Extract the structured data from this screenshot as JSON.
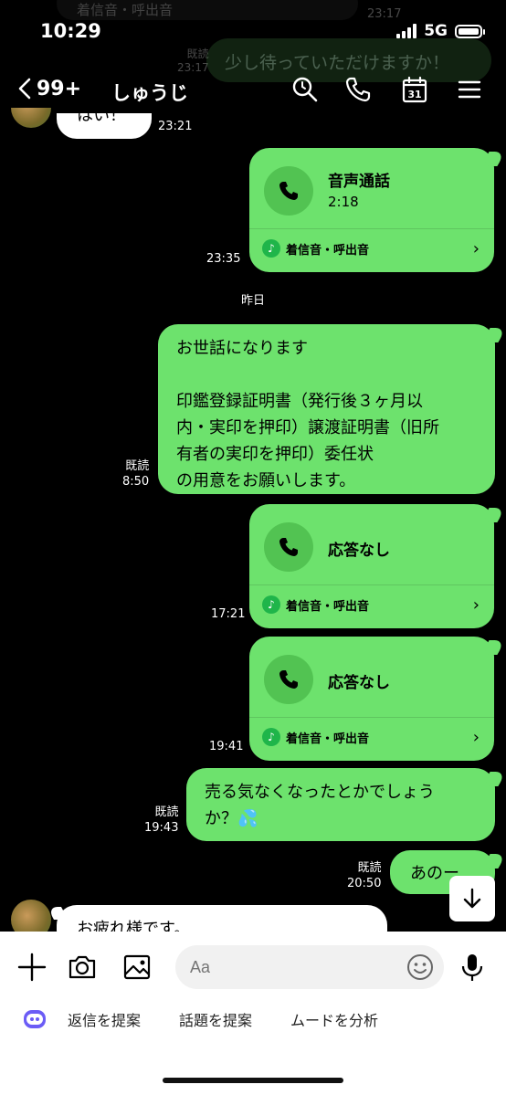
{
  "status": {
    "time": "10:29",
    "network": "5G"
  },
  "faded": {
    "top_text": "着信音・呼出音",
    "top_time": "23:17",
    "read": "既読",
    "read_time": "23:17",
    "green_text": "少し待っていただけますか！"
  },
  "header": {
    "back_count": "99+",
    "title": "しゅうじ"
  },
  "messages": {
    "incoming_top": {
      "text": "はい！",
      "time": "23:21"
    },
    "call1": {
      "title": "音声通話",
      "duration": "2:18",
      "ringtone": "着信音・呼出音",
      "time": "23:35"
    },
    "date_separator": "昨日",
    "text1": {
      "lines": [
        "お世話になります",
        "",
        "印鑑登録証明書（発行後３ヶ月以",
        "内・実印を押印）譲渡証明書（旧所",
        "有者の実印を押印）委任状",
        "の用意をお願いします。"
      ],
      "read": "既読",
      "time": "8:50"
    },
    "call2": {
      "title": "応答なし",
      "ringtone": "着信音・呼出音",
      "time": "17:21"
    },
    "call3": {
      "title": "応答なし",
      "ringtone": "着信音・呼出音",
      "time": "19:41"
    },
    "text2": {
      "line1": "売る気なくなったとかでしょう",
      "line2": "か？💦",
      "read": "既読",
      "time": "19:43"
    },
    "text3": {
      "text": "あのー",
      "read": "既読",
      "time": "20:50"
    },
    "incoming_bottom": {
      "text": "お疲れ様です。"
    }
  },
  "input": {
    "placeholder": "Aa"
  },
  "suggestions": {
    "reply": "返信を提案",
    "topic": "話題を提案",
    "mood": "ムードを分析"
  }
}
